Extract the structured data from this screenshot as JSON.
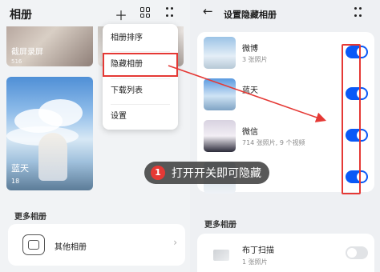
{
  "left": {
    "title": "相册",
    "albums_top": [
      {
        "caption": "截屏录屏",
        "count": "516"
      },
      {
        "caption": "",
        "count": ""
      }
    ],
    "featured": {
      "caption": "蓝天",
      "count": "18"
    },
    "more_title": "更多相册",
    "other_album": "其他相册"
  },
  "menu": {
    "items": [
      "相册排序",
      "隐藏相册",
      "下载列表",
      "设置"
    ]
  },
  "right": {
    "title": "设置隐藏相册",
    "albums": [
      {
        "name": "微博",
        "sub": "3 张照片",
        "on": true
      },
      {
        "name": "蓝天",
        "sub": "",
        "on": true
      },
      {
        "name": "微信",
        "sub": "714 张照片, 9 个视频",
        "on": true
      },
      {
        "name": "",
        "sub": "",
        "on": true
      }
    ],
    "more_title": "更多相册",
    "more_albums": [
      {
        "name": "布丁扫描",
        "sub": "1 张照片",
        "on": false
      }
    ]
  },
  "callout": {
    "number": "1",
    "text": "打开开关即可隐藏"
  },
  "colors": {
    "accent": "#0a59f7",
    "highlight": "#e53935"
  },
  "icons": [
    "plus-icon",
    "grid-icon",
    "more-dots-icon",
    "back-arrow-icon",
    "chevron-right-icon"
  ]
}
